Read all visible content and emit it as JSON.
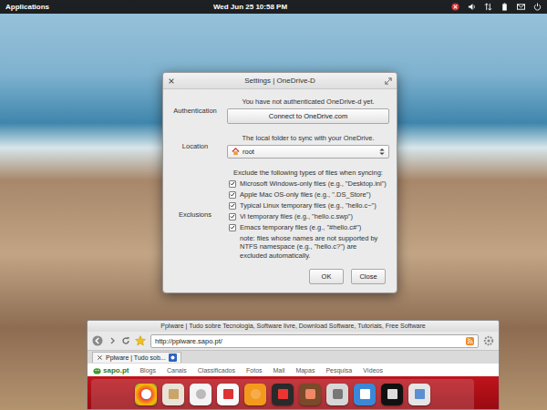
{
  "top_panel": {
    "applications": "Applications",
    "clock": "Wed Jun 25 10:58 PM"
  },
  "dialog": {
    "title": "Settings | OneDrive-D",
    "authentication": {
      "label": "Authentication",
      "message": "You have not authenticated OneDrive-d yet.",
      "button": "Connect to OneDrive.com"
    },
    "location": {
      "label": "Location",
      "message": "The local folder to sync with your OneDrive.",
      "value": "root"
    },
    "exclusions": {
      "label": "Exclusions",
      "heading": "Exclude the following types of files when syncing:",
      "items": [
        {
          "label": "Microsoft Windows-only files (e.g., \"Desktop.ini\")",
          "checked": true
        },
        {
          "label": "Apple Mac OS-only files (e.g., \".DS_Store\")",
          "checked": true
        },
        {
          "label": "Typical Linux temporary files (e.g., \"hello.c~\")",
          "checked": true
        },
        {
          "label": "Vi temporary files (e.g., \"hello.c.swp\")",
          "checked": true
        },
        {
          "label": "Emacs temporary files (e.g., \"#hello.c#\")",
          "checked": true
        }
      ],
      "note": "note: files whose names are not supported by NTFS namespace (e.g., \"hello.c?\") are excluded automatically."
    },
    "buttons": [
      "OK",
      "Close"
    ]
  },
  "browser": {
    "title": "Pplware | Tudo sobre Tecnologia, Software livre, Download Software, Tutoriais, Free Software",
    "url": "http://pplware.sapo.pt/",
    "tabs": [
      {
        "label": "Pplware | Tudo sob...",
        "selected": true
      }
    ],
    "site_logo": "sapo.pt",
    "nav": [
      "Blogs",
      "Canais",
      "Classificados",
      "Fotos",
      "Mail",
      "Mapas",
      "Pesquisa",
      "Vídeos"
    ]
  }
}
